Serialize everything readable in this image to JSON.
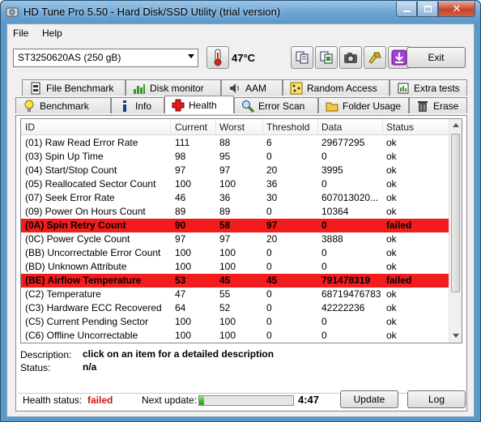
{
  "window": {
    "title": "HD Tune Pro 5.50 - Hard Disk/SSD Utility (trial version)"
  },
  "menu": [
    "File",
    "Help"
  ],
  "toolbar": {
    "drive": "ST3250620AS (250 gB)",
    "temperature": "47°C",
    "exit_label": "Exit",
    "icons": [
      "thermometer-icon",
      "copy-icon",
      "copy-info-icon",
      "screenshot-camera-icon",
      "options-icon",
      "save-download-icon"
    ]
  },
  "tabs_row1": [
    {
      "label": "File Benchmark",
      "icon": "file-benchmark-icon"
    },
    {
      "label": "Disk monitor",
      "icon": "disk-monitor-icon"
    },
    {
      "label": "AAM",
      "icon": "speaker-icon"
    },
    {
      "label": "Random Access",
      "icon": "random-access-icon"
    },
    {
      "label": "Extra tests",
      "icon": "extra-tests-icon"
    }
  ],
  "tabs_row2": [
    {
      "label": "Benchmark",
      "icon": "benchmark-bulb-icon"
    },
    {
      "label": "Info",
      "icon": "info-icon"
    },
    {
      "label": "Health",
      "icon": "health-cross-icon",
      "active": true
    },
    {
      "label": "Error Scan",
      "icon": "magnifier-icon"
    },
    {
      "label": "Folder Usage",
      "icon": "folder-icon"
    },
    {
      "label": "Erase",
      "icon": "trash-icon"
    }
  ],
  "table": {
    "columns": [
      "ID",
      "Current",
      "Worst",
      "Threshold",
      "Data",
      "Status"
    ],
    "rows": [
      {
        "id": "(01) Raw Read Error Rate",
        "current": "111",
        "worst": "88",
        "threshold": "6",
        "data": "29677295",
        "status": "ok"
      },
      {
        "id": "(03) Spin Up Time",
        "current": "98",
        "worst": "95",
        "threshold": "0",
        "data": "0",
        "status": "ok"
      },
      {
        "id": "(04) Start/Stop Count",
        "current": "97",
        "worst": "97",
        "threshold": "20",
        "data": "3995",
        "status": "ok"
      },
      {
        "id": "(05) Reallocated Sector Count",
        "current": "100",
        "worst": "100",
        "threshold": "36",
        "data": "0",
        "status": "ok"
      },
      {
        "id": "(07) Seek Error Rate",
        "current": "46",
        "worst": "36",
        "threshold": "30",
        "data": "607013020...",
        "status": "ok"
      },
      {
        "id": "(09) Power On Hours Count",
        "current": "89",
        "worst": "89",
        "threshold": "0",
        "data": "10364",
        "status": "ok"
      },
      {
        "id": "(0A) Spin Retry Count",
        "current": "90",
        "worst": "58",
        "threshold": "97",
        "data": "0",
        "status": "failed",
        "failed": true
      },
      {
        "id": "(0C) Power Cycle Count",
        "current": "97",
        "worst": "97",
        "threshold": "20",
        "data": "3888",
        "status": "ok"
      },
      {
        "id": "(BB) Uncorrectable Error Count",
        "current": "100",
        "worst": "100",
        "threshold": "0",
        "data": "0",
        "status": "ok"
      },
      {
        "id": "(BD) Unknown Attribute",
        "current": "100",
        "worst": "100",
        "threshold": "0",
        "data": "0",
        "status": "ok"
      },
      {
        "id": "(BE) Airflow Temperature",
        "current": "53",
        "worst": "45",
        "threshold": "45",
        "data": "791478319",
        "status": "failed",
        "failed": true
      },
      {
        "id": "(C2) Temperature",
        "current": "47",
        "worst": "55",
        "threshold": "0",
        "data": "68719476783",
        "status": "ok"
      },
      {
        "id": "(C3) Hardware ECC Recovered",
        "current": "64",
        "worst": "52",
        "threshold": "0",
        "data": "42222236",
        "status": "ok"
      },
      {
        "id": "(C5) Current Pending Sector",
        "current": "100",
        "worst": "100",
        "threshold": "0",
        "data": "0",
        "status": "ok"
      },
      {
        "id": "(C6) Offline Uncorrectable",
        "current": "100",
        "worst": "100",
        "threshold": "0",
        "data": "0",
        "status": "ok"
      }
    ]
  },
  "description": {
    "label": "Description:",
    "value": "click on an item for a detailed description"
  },
  "status": {
    "label": "Status:",
    "value": "n/a"
  },
  "footer": {
    "health_label": "Health status:",
    "health_value": "failed",
    "next_update_label": "Next update:",
    "next_update_progress": 0.05,
    "next_update_time": "4:47",
    "update_button": "Update",
    "log_button": "Log"
  },
  "colors": {
    "failed_row": "#f21c1c",
    "failed_text": "#d01010",
    "progress": "#3bb526",
    "titlebar": "#6aa3d2"
  }
}
